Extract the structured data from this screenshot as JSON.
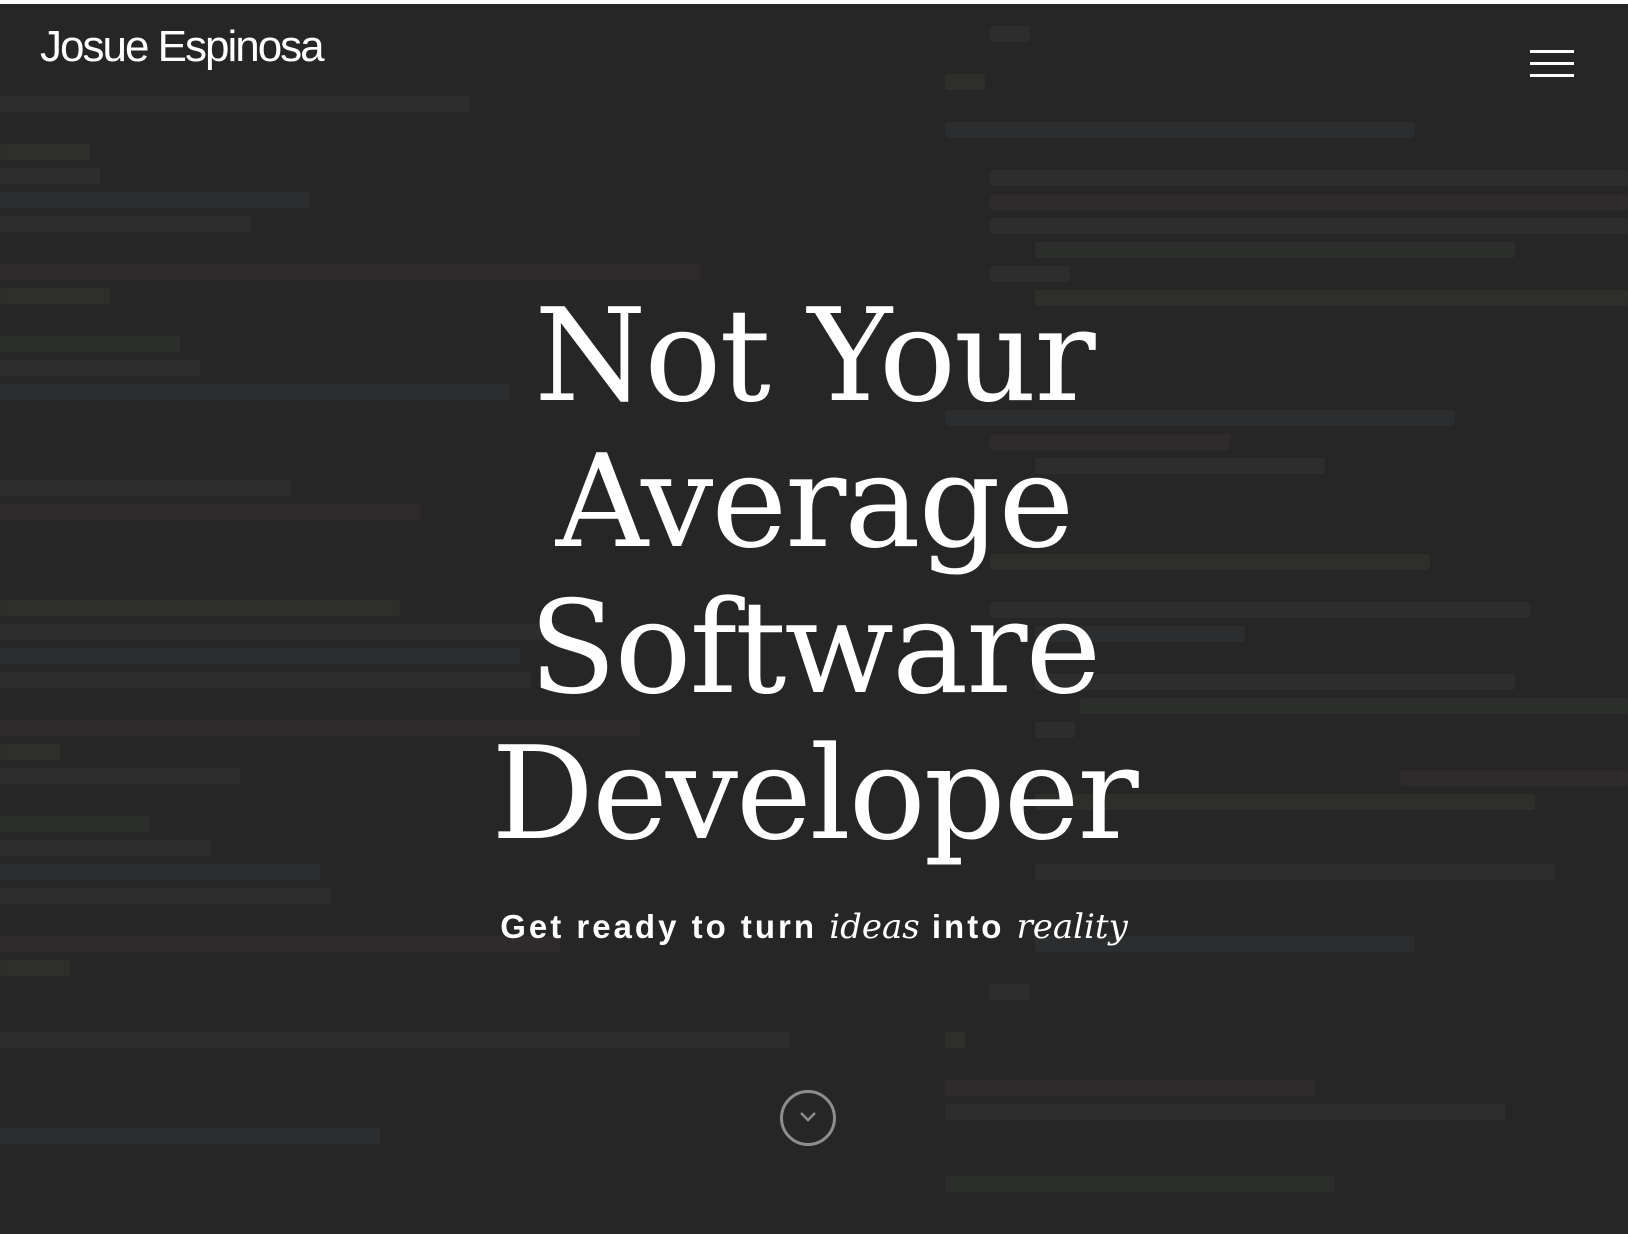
{
  "header": {
    "brand": "Josue Espinosa",
    "menu_icon": "hamburger-menu-icon"
  },
  "hero": {
    "headline_lines": [
      "Not Your",
      "Average",
      "Software",
      "Developer"
    ],
    "tagline": {
      "part1": "Get ready to turn ",
      "emphasis1": "ideas",
      "part2": " into ",
      "emphasis2": "reality"
    },
    "scroll_icon": "chevron-down-icon"
  },
  "colors": {
    "background": "#262626",
    "text": "#ffffff",
    "scroll_ring": "#8d8d8d"
  }
}
